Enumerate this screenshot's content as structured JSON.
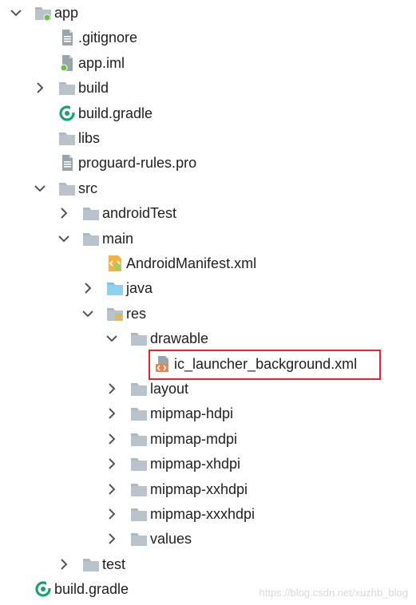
{
  "tree": [
    {
      "label": "app",
      "depth": 0,
      "icon": "module-folder-icon",
      "expand": "expanded"
    },
    {
      "label": ".gitignore",
      "depth": 1,
      "icon": "text-file-icon",
      "expand": "none"
    },
    {
      "label": "app.iml",
      "depth": 1,
      "icon": "iml-file-icon",
      "expand": "none"
    },
    {
      "label": "build",
      "depth": 1,
      "icon": "folder-icon",
      "expand": "collapsed"
    },
    {
      "label": "build.gradle",
      "depth": 1,
      "icon": "gradle-icon",
      "expand": "none"
    },
    {
      "label": "libs",
      "depth": 1,
      "icon": "folder-icon",
      "expand": "none"
    },
    {
      "label": "proguard-rules.pro",
      "depth": 1,
      "icon": "text-file-icon",
      "expand": "none"
    },
    {
      "label": "src",
      "depth": 1,
      "icon": "folder-icon",
      "expand": "expanded"
    },
    {
      "label": "androidTest",
      "depth": 2,
      "icon": "folder-icon",
      "expand": "collapsed"
    },
    {
      "label": "main",
      "depth": 2,
      "icon": "folder-icon",
      "expand": "expanded"
    },
    {
      "label": "AndroidManifest.xml",
      "depth": 3,
      "icon": "android-manifest-icon",
      "expand": "none"
    },
    {
      "label": "java",
      "depth": 3,
      "icon": "source-folder-icon",
      "expand": "collapsed"
    },
    {
      "label": "res",
      "depth": 3,
      "icon": "resource-folder-icon",
      "expand": "expanded"
    },
    {
      "label": "drawable",
      "depth": 4,
      "icon": "folder-icon",
      "expand": "expanded"
    },
    {
      "label": "ic_launcher_background.xml",
      "depth": 5,
      "icon": "xml-file-icon",
      "expand": "none",
      "highlighted": true
    },
    {
      "label": "layout",
      "depth": 4,
      "icon": "folder-icon",
      "expand": "collapsed"
    },
    {
      "label": "mipmap-hdpi",
      "depth": 4,
      "icon": "folder-icon",
      "expand": "collapsed"
    },
    {
      "label": "mipmap-mdpi",
      "depth": 4,
      "icon": "folder-icon",
      "expand": "collapsed"
    },
    {
      "label": "mipmap-xhdpi",
      "depth": 4,
      "icon": "folder-icon",
      "expand": "collapsed"
    },
    {
      "label": "mipmap-xxhdpi",
      "depth": 4,
      "icon": "folder-icon",
      "expand": "collapsed"
    },
    {
      "label": "mipmap-xxxhdpi",
      "depth": 4,
      "icon": "folder-icon",
      "expand": "collapsed"
    },
    {
      "label": "values",
      "depth": 4,
      "icon": "folder-icon",
      "expand": "collapsed"
    },
    {
      "label": "test",
      "depth": 2,
      "icon": "folder-icon",
      "expand": "collapsed"
    },
    {
      "label": "build.gradle",
      "depth": 0,
      "icon": "gradle-icon",
      "expand": "none"
    }
  ],
  "watermark": "https://blog.csdn.net/xuzhb_blog",
  "colors": {
    "highlight_border": "#e5252a",
    "folder": "#aeb9c2",
    "source_folder": "#8fcff0",
    "gradle": "#1aa36f",
    "module_dot": "#6cc04a",
    "xml_badge": "#e8844e",
    "android_green": "#9bd05a"
  }
}
